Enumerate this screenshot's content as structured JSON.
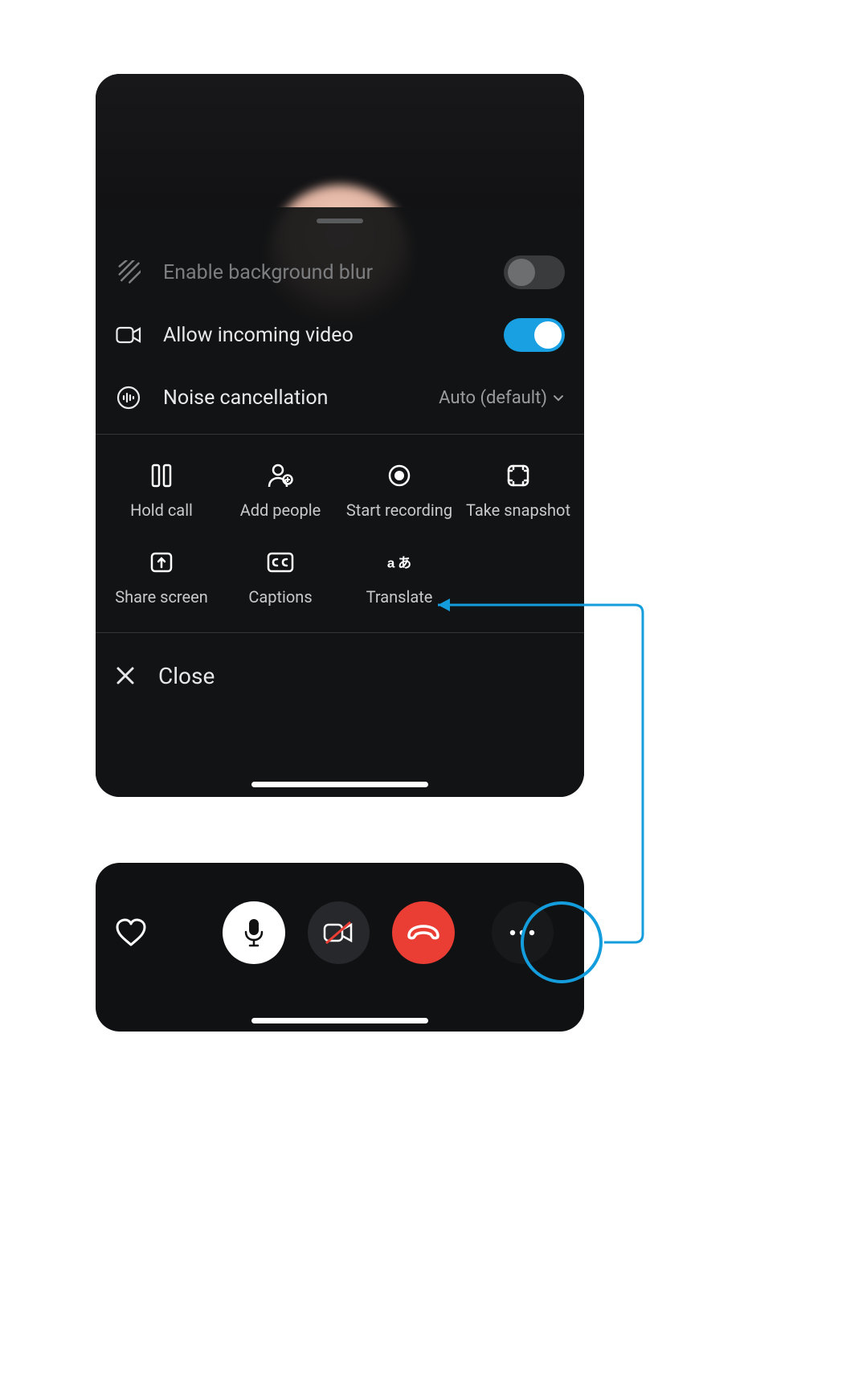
{
  "settings": {
    "bg_blur": {
      "label": "Enable background blur",
      "on": false
    },
    "incoming_video": {
      "label": "Allow incoming video",
      "on": true
    },
    "noise_cancel": {
      "label": "Noise cancellation",
      "value": "Auto (default)"
    }
  },
  "actions": {
    "hold": "Hold call",
    "add_people": "Add people",
    "start_recording": "Start recording",
    "take_snapshot": "Take snapshot",
    "share_screen": "Share screen",
    "captions": "Captions",
    "translate": "Translate"
  },
  "close_label": "Close",
  "colors": {
    "accent": "#18a0e2",
    "hangup": "#ea3e35",
    "callout": "#149ddc"
  }
}
